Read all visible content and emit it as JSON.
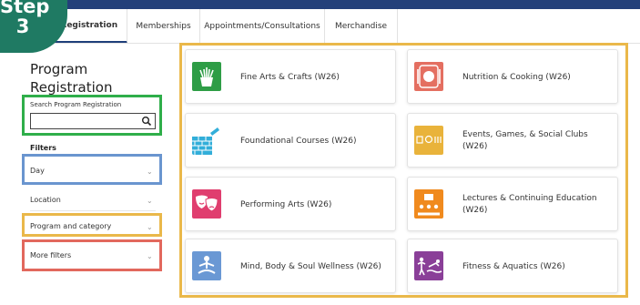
{
  "badge": {
    "line1": "Step",
    "line2": "3"
  },
  "tabs": [
    {
      "label": "Program Registration",
      "visible_label": "m Registration"
    },
    {
      "label": "Memberships"
    },
    {
      "label": "Appointments/Consultations"
    },
    {
      "label": "Merchandise"
    }
  ],
  "sidebar": {
    "title": "Program Registration",
    "search": {
      "label": "Search Program Registration",
      "value": "",
      "placeholder": ""
    },
    "filters_heading": "Filters",
    "filters": [
      {
        "label": "Day"
      },
      {
        "label": "Location"
      },
      {
        "label": "Program and category"
      },
      {
        "label": "More filters"
      }
    ]
  },
  "categories": [
    {
      "label": "Fine Arts & Crafts (W26)",
      "icon": "plant-pot-icon",
      "color": "#2e9d46"
    },
    {
      "label": "Nutrition & Cooking (W26)",
      "icon": "plate-cutlery-icon",
      "color": "#e46f61"
    },
    {
      "label": "Foundational Courses (W26)",
      "icon": "brick-wall-icon",
      "color": "#32aed9"
    },
    {
      "label": "Events, Games, & Social Clubs (W26)",
      "icon": "events-icon",
      "color": "#e9b33b"
    },
    {
      "label": "Performing Arts (W26)",
      "icon": "theatre-masks-icon",
      "color": "#e03e6f"
    },
    {
      "label": "Lectures & Continuing Education (W26)",
      "icon": "lecture-icon",
      "color": "#f08a1e"
    },
    {
      "label": "Mind, Body & Soul Wellness (W26)",
      "icon": "meditation-icon",
      "color": "#6a98d4"
    },
    {
      "label": "Fitness & Aquatics (W26)",
      "icon": "swimmer-icon",
      "color": "#8a3f98"
    }
  ],
  "colors": {
    "nav_bar": "#23407a",
    "badge": "#1f7a63",
    "highlight_green": "#2fae4a",
    "highlight_blue": "#6a95cf",
    "highlight_yellow": "#eab84a",
    "highlight_red": "#e2685d"
  }
}
